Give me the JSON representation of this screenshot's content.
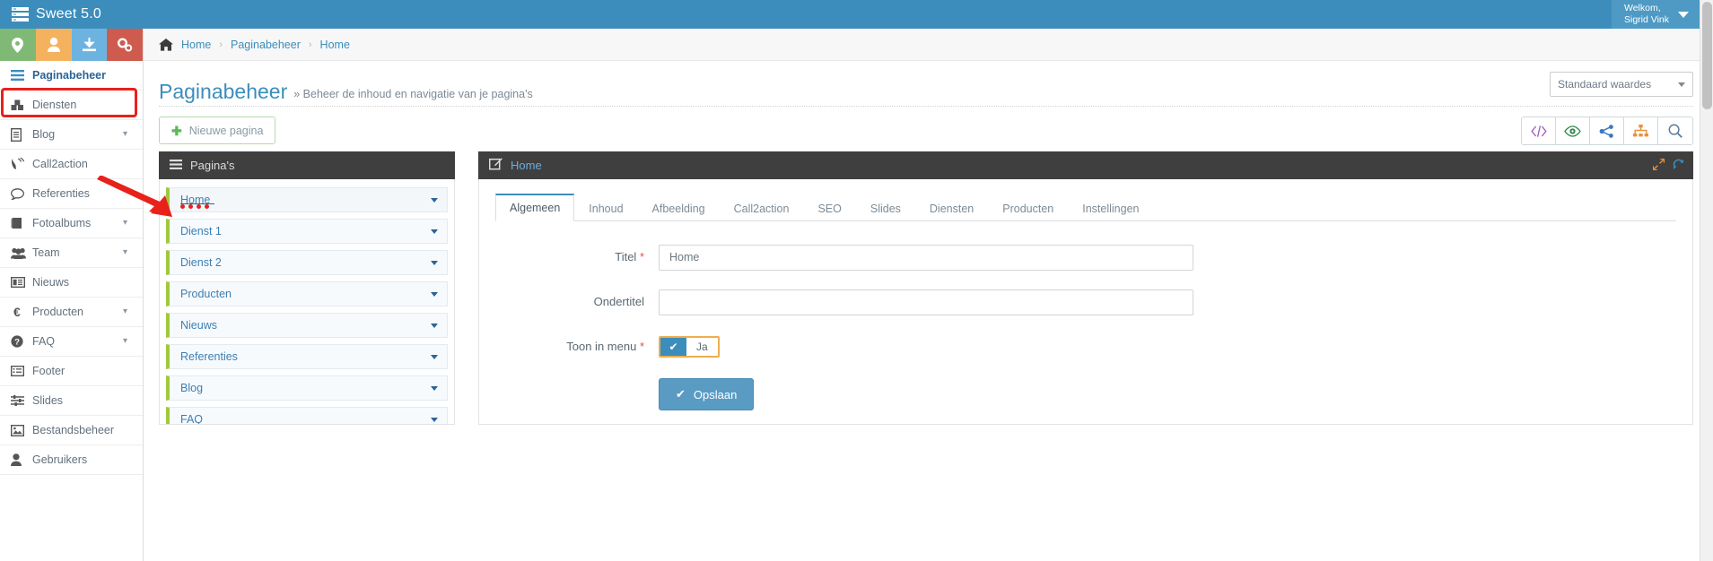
{
  "topbar": {
    "brand": "Sweet 5.0",
    "brand_icon": "server-stack-icon",
    "user_welcome": "Welkom,",
    "user_name": "Sigrid Vink"
  },
  "sidebar": {
    "quick_icons": [
      {
        "name": "map-marker-icon",
        "color": "#80b976"
      },
      {
        "name": "user-icon",
        "color": "#f5b25e"
      },
      {
        "name": "download-icon",
        "color": "#6db3e0"
      },
      {
        "name": "cogs-icon",
        "color": "#cf5b4e"
      }
    ],
    "items": [
      {
        "label": "Paginabeheer",
        "icon": "bars-icon",
        "active": true,
        "chevron": false
      },
      {
        "label": "Diensten",
        "icon": "cubes-icon",
        "active": false,
        "chevron": false
      },
      {
        "label": "Blog",
        "icon": "file-icon",
        "active": false,
        "chevron": true
      },
      {
        "label": "Call2action",
        "icon": "phone-volume-icon",
        "active": false,
        "chevron": false
      },
      {
        "label": "Referenties",
        "icon": "comment-icon",
        "active": false,
        "chevron": false
      },
      {
        "label": "Fotoalbums",
        "icon": "book-icon",
        "active": false,
        "chevron": true
      },
      {
        "label": "Team",
        "icon": "users-icon",
        "active": false,
        "chevron": true
      },
      {
        "label": "Nieuws",
        "icon": "newspaper-icon",
        "active": false,
        "chevron": false
      },
      {
        "label": "Producten",
        "icon": "euro-icon",
        "active": false,
        "chevron": true
      },
      {
        "label": "FAQ",
        "icon": "question-circle-icon",
        "active": false,
        "chevron": true
      },
      {
        "label": "Footer",
        "icon": "list-alt-icon",
        "active": false,
        "chevron": false
      },
      {
        "label": "Slides",
        "icon": "sliders-icon",
        "active": false,
        "chevron": false
      },
      {
        "label": "Bestandsbeheer",
        "icon": "image-icon",
        "active": false,
        "chevron": false
      },
      {
        "label": "Gebruikers",
        "icon": "user-icon",
        "active": false,
        "chevron": false
      }
    ]
  },
  "breadcrumb": {
    "home_icon": "home-icon",
    "items": [
      "Home",
      "Paginabeheer",
      "Home"
    ],
    "separator": "›"
  },
  "page": {
    "title": "Paginabeheer",
    "subtitle": "» Beheer de inhoud en navigatie van je pagina's",
    "preset_select": "Standaard waardes"
  },
  "toolbar": {
    "new_page_label": "Nieuwe pagina",
    "new_page_icon": "plus-icon",
    "icons": [
      {
        "name": "code-icon",
        "glyph": "</>",
        "color": "#9b59b6"
      },
      {
        "name": "eye-icon",
        "glyph": "eye",
        "color": "#2e8b4a"
      },
      {
        "name": "share-alt-icon",
        "glyph": "share",
        "color": "#3b78c3"
      },
      {
        "name": "sitemap-icon",
        "glyph": "sitemap",
        "color": "#e8913a"
      },
      {
        "name": "search-icon",
        "glyph": "search",
        "color": "#5b7c99"
      }
    ]
  },
  "pages_panel": {
    "title": "Pagina's",
    "title_icon": "bars-icon",
    "items": [
      {
        "label": "Home",
        "selected": true
      },
      {
        "label": "Dienst 1",
        "selected": false
      },
      {
        "label": "Dienst 2",
        "selected": false
      },
      {
        "label": "Producten",
        "selected": false
      },
      {
        "label": "Nieuws",
        "selected": false
      },
      {
        "label": "Referenties",
        "selected": false
      },
      {
        "label": "Blog",
        "selected": false
      },
      {
        "label": "FAQ",
        "selected": false
      }
    ]
  },
  "edit_panel": {
    "title": "Home",
    "title_icon": "edit-icon",
    "expand_icon": "expand-icon",
    "refresh_icon": "refresh-icon",
    "tabs": [
      {
        "label": "Algemeen",
        "active": true
      },
      {
        "label": "Inhoud",
        "active": false
      },
      {
        "label": "Afbeelding",
        "active": false
      },
      {
        "label": "Call2action",
        "active": false
      },
      {
        "label": "SEO",
        "active": false
      },
      {
        "label": "Slides",
        "active": false
      },
      {
        "label": "Diensten",
        "active": false
      },
      {
        "label": "Producten",
        "active": false
      },
      {
        "label": "Instellingen",
        "active": false
      }
    ],
    "fields": {
      "titel_label": "Titel",
      "titel_required": "*",
      "titel_value": "Home",
      "ondertitel_label": "Ondertitel",
      "ondertitel_value": "",
      "toon_label": "Toon in menu",
      "toon_required": "*",
      "toon_value": "Ja",
      "toon_check": "✔"
    },
    "save_label": "Opslaan",
    "save_icon": "check-icon"
  },
  "annotations": {
    "highlight_color": "#e8211b",
    "arrow_color": "#e8211b"
  }
}
